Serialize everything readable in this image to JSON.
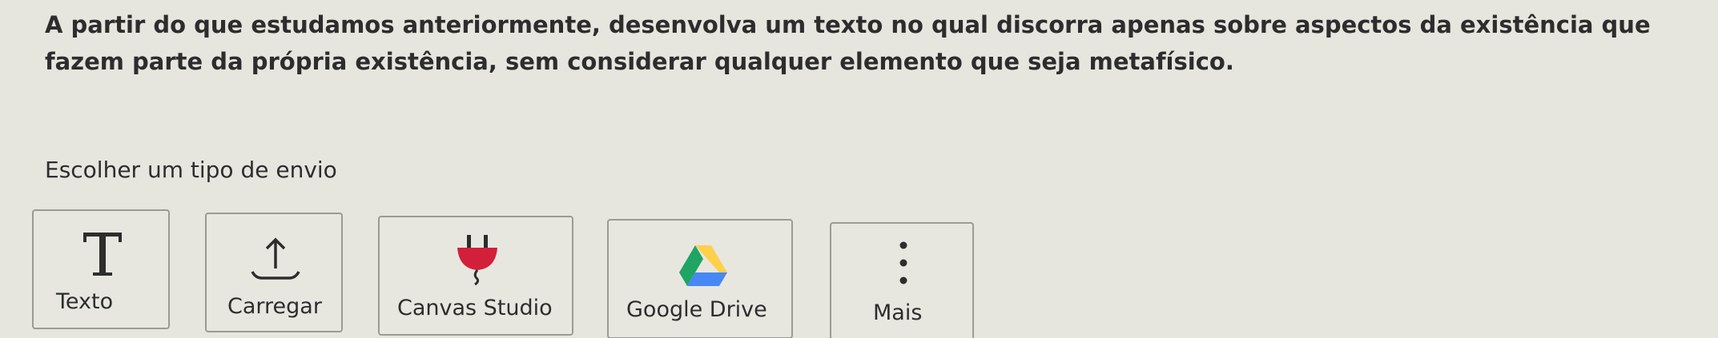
{
  "assignment": {
    "prompt": "A partir do que estudamos anteriormente, desenvolva um texto no qual discorra apenas sobre aspectos da existência que fazem parte da própria existência, sem considerar qualquer elemento que seja metafísico."
  },
  "submission": {
    "heading": "Escolher um tipo de envio",
    "options": [
      {
        "label": "Texto",
        "icon": "text-t-icon"
      },
      {
        "label": "Carregar",
        "icon": "upload-icon"
      },
      {
        "label": "Canvas Studio",
        "icon": "plug-icon"
      },
      {
        "label": "Google Drive",
        "icon": "google-drive-icon"
      },
      {
        "label": "Mais",
        "icon": "more-vertical-icon"
      }
    ]
  },
  "colors": {
    "background": "#e6e6df",
    "tile_border": "#9b9b96",
    "text": "#2d2d2d",
    "plug_red": "#d2203a",
    "drive_green": "#1fa463",
    "drive_yellow": "#ffd04b",
    "drive_blue": "#4688f4"
  }
}
